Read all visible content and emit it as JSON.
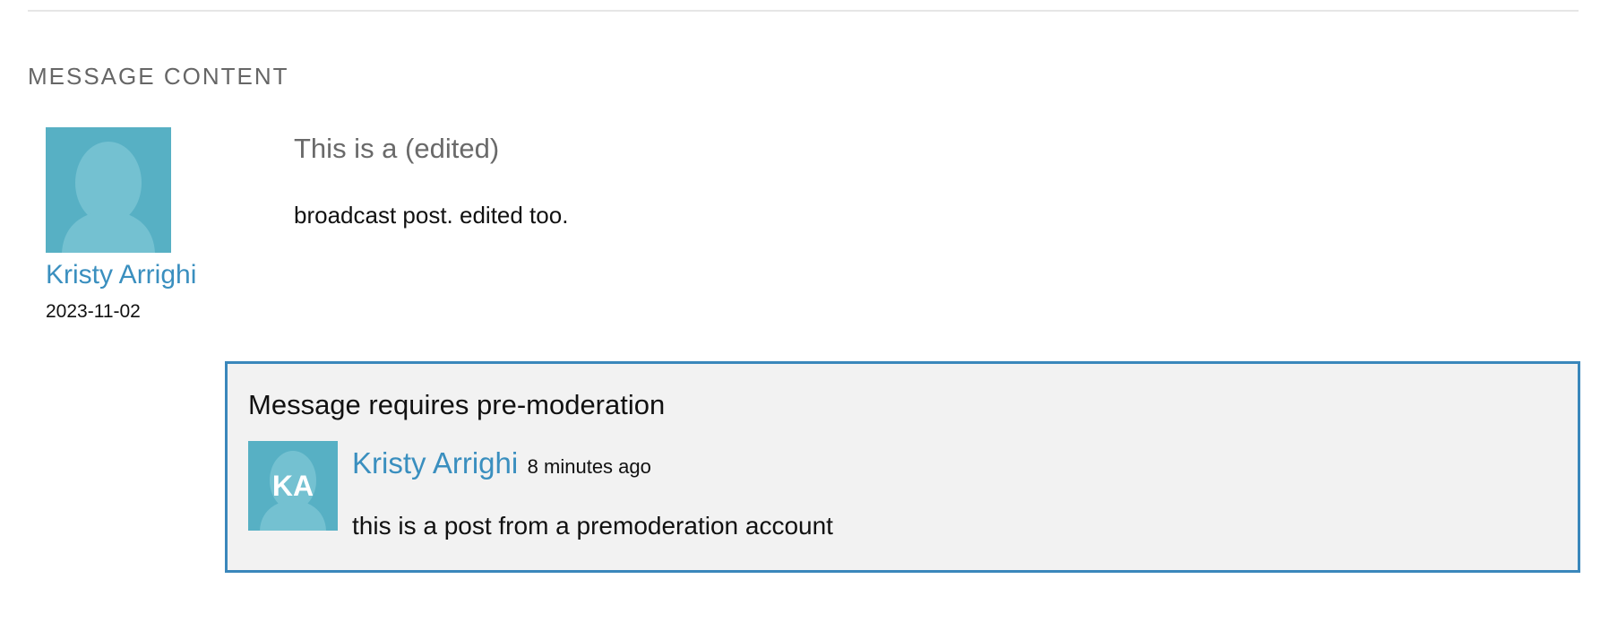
{
  "section": {
    "title": "MESSAGE CONTENT"
  },
  "post": {
    "author_name": "Kristy Arrighi",
    "date": "2023-11-02",
    "subject": "This is a (edited)",
    "body": "broadcast post. edited too.",
    "avatar_icon": "default-person-avatar-icon"
  },
  "moderation": {
    "title": "Message requires pre-moderation",
    "avatar_initials": "KA",
    "author_name": "Kristy Arrighi",
    "time_ago": "8 minutes ago",
    "text": "this is a post from a premoderation account"
  },
  "colors": {
    "link": "#3a8fbf",
    "avatar_bg": "#57b0c4",
    "panel_border": "#3a87bb",
    "panel_bg": "#f2f2f2"
  }
}
